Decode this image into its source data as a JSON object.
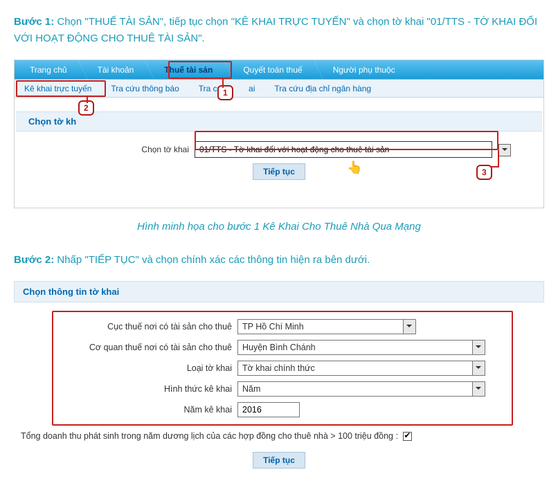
{
  "step1": {
    "label": "Bước 1:",
    "text": " Chọn \"THUẾ TÀI SẢN\", tiếp tục chọn \"KÊ KHAI TRỰC TUYẾN\" và chọn tờ khai \"01/TTS - TỜ KHAI ĐỐI VỚI HOẠT ĐỘNG CHO THUÊ TÀI SẢN\"."
  },
  "tabs_main": {
    "t0": "Trang chủ",
    "t1": "Tài khoản",
    "t2": "Thuế tài sản",
    "t3": "Quyết toán thuế",
    "t4": "Người phụ thuộc"
  },
  "tabs_sub": {
    "s0": "Kê khai trực tuyến",
    "s1": "Tra cứu thông báo",
    "s2_pre": "Tra cứu",
    "s2_post": "ai",
    "s3": "Tra cứu địa chỉ ngân hàng"
  },
  "panel1_title": "Chọn tờ kh",
  "choose_label": "Chọn tờ khai",
  "choose_value": "01/TTS - Tờ khai đối với hoạt động cho thuê tài sản",
  "continue_btn": "Tiếp tục",
  "ann": {
    "n1": "1",
    "n2": "2",
    "n3": "3"
  },
  "caption1": "Hình minh họa cho bước 1 Kê Khai Cho Thuê Nhà Qua Mạng",
  "step2": {
    "label": "Bước 2:",
    "text": " Nhấp \"TIẾP TỤC\" và chọn chính xác các thông tin hiện ra bên dưới."
  },
  "panel2_title": "Chọn thông tin tờ khai",
  "form": {
    "l0": "Cục thuế nơi có tài sản cho thuê",
    "v0": "TP Hồ Chí Minh",
    "l1": "Cơ quan thuế nơi có tài sản cho thuê",
    "v1": "Huyện Bình Chánh",
    "l2": "Loại tờ khai",
    "v2": "Tờ khai chính thức",
    "l3": "Hình thức kê khai",
    "v3": "Năm",
    "l4": "Năm kê khai",
    "v4": "2016"
  },
  "check_text": "Tổng doanh thu phát sinh trong năm dương lịch của các hợp đồng cho thuê nhà > 100 triệu đồng :",
  "continue_btn2": "Tiếp tục",
  "cursor_glyph": "👆"
}
